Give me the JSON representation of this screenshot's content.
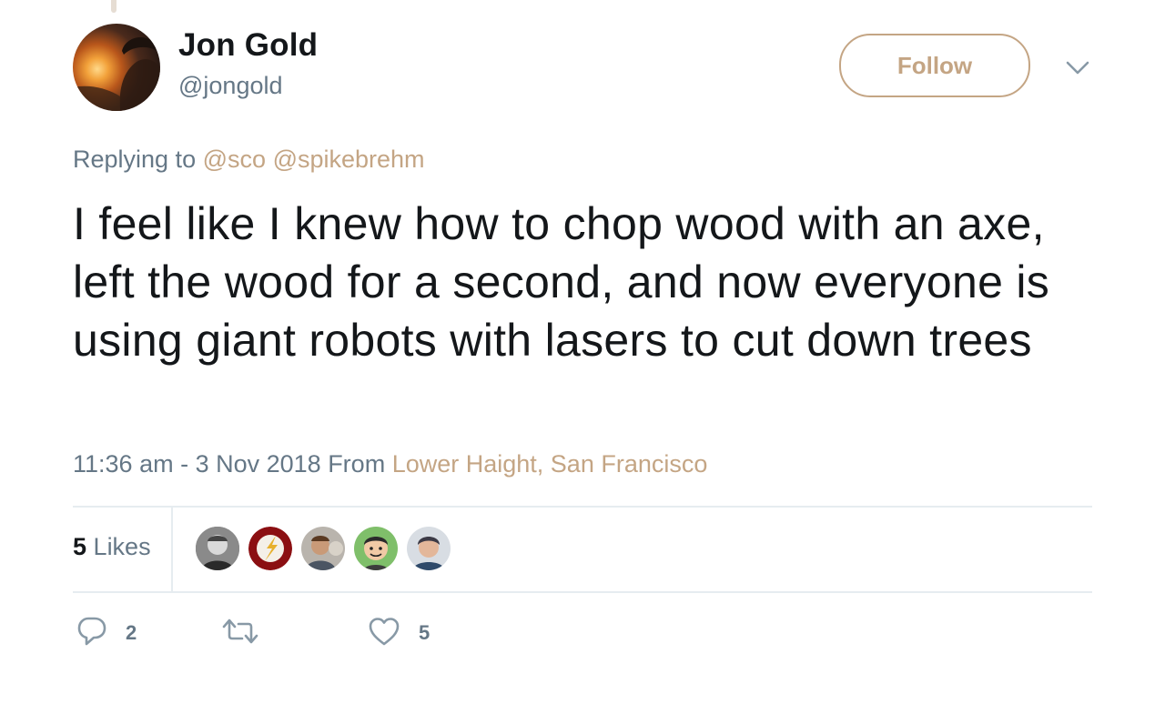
{
  "tweet": {
    "author": {
      "name": "Jon Gold",
      "handle": "@jongold"
    },
    "follow_label": "Follow",
    "reply_prefix": "Replying to",
    "reply_mentions": [
      "@sco",
      "@spikebrehm"
    ],
    "text": "I feel like I knew how to chop wood with an axe, left the wood for a second, and now everyone is using giant robots with lasers to cut down trees",
    "timestamp": "11:36 am - 3 Nov 2018",
    "from_label": "From",
    "location": "Lower Haight, San Francisco",
    "likes": {
      "count": "5",
      "label": "Likes"
    },
    "actions": {
      "reply_count": "2",
      "retweet_count": "",
      "like_count": "5"
    }
  },
  "icons": {
    "caret": "chevron-down-icon",
    "reply": "reply-icon",
    "retweet": "retweet-icon",
    "like": "heart-icon"
  },
  "colors": {
    "accent": "#c4a584",
    "secondary_text": "#657786",
    "primary_text": "#14171a",
    "divider": "#e6ecf0"
  }
}
